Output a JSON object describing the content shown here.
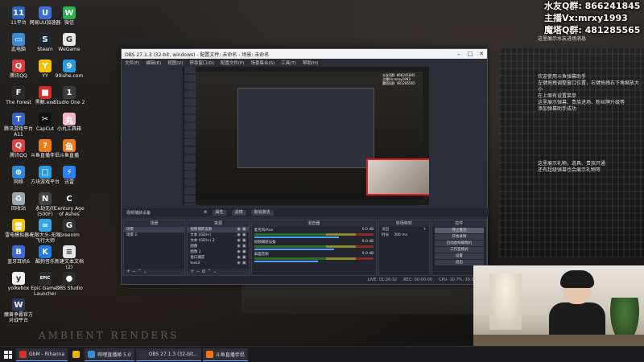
{
  "desktop": {
    "wallpaper_caption": "AMBIENT RENDERS",
    "icons": [
      {
        "label": "11平台",
        "icon": "platform-icon",
        "color": "#2a63c4",
        "glyph": "11"
      },
      {
        "label": "网易UU加速器",
        "icon": "uu-accelerator-icon",
        "color": "#3a6fd8",
        "glyph": "U"
      },
      {
        "label": "微信",
        "icon": "wechat-icon",
        "color": "#27b24a",
        "glyph": "W"
      },
      {
        "label": "此电脑",
        "icon": "computer-icon",
        "color": "#3b8ad9",
        "glyph": "▭"
      },
      {
        "label": "Steam",
        "icon": "steam-icon",
        "color": "#1b2838",
        "glyph": "S"
      },
      {
        "label": "WeGame",
        "icon": "wegame-icon",
        "color": "#e8e8e8",
        "glyph": "G"
      },
      {
        "label": "腾讯QQ",
        "icon": "qq-icon",
        "color": "#e03a3a",
        "glyph": "Q"
      },
      {
        "label": "YY",
        "icon": "yy-icon",
        "color": "#f4c200",
        "glyph": "Y"
      },
      {
        "label": "99ishe.com",
        "icon": "web-icon",
        "color": "#2a9be0",
        "glyph": "9"
      },
      {
        "label": "The Forest",
        "icon": "the-forest-icon",
        "color": "#2b2b2b",
        "glyph": "F"
      },
      {
        "label": "黑鲸.exe",
        "icon": "app-icon",
        "color": "#d92a2a",
        "glyph": "■"
      },
      {
        "label": "Studio One 2",
        "icon": "studio-one-icon",
        "color": "#3c3c3c",
        "glyph": "1"
      },
      {
        "label": "腾讯游戏平台\nA11",
        "icon": "tencent-game-icon",
        "color": "#3464c8",
        "glyph": "T"
      },
      {
        "label": "CapCut",
        "icon": "capcut-icon",
        "color": "#111111",
        "glyph": "✂"
      },
      {
        "label": "小丸工具箱",
        "icon": "toolbox-icon",
        "color": "#f1b6c8",
        "glyph": "丸"
      },
      {
        "label": "腾讯QQ",
        "icon": "qq-icon-2",
        "color": "#e04040",
        "glyph": "Q"
      },
      {
        "label": "斗鱼直播伴侣",
        "icon": "douyu-companion-icon",
        "color": "#f07a1a",
        "glyph": "?"
      },
      {
        "label": "斗鱼直播",
        "icon": "douyu-icon",
        "color": "#f07a1a",
        "glyph": "鱼"
      },
      {
        "label": "网络",
        "icon": "network-icon",
        "color": "#2a8ad9",
        "glyph": "⊕"
      },
      {
        "label": "方块游戏平台",
        "icon": "cube-game-icon",
        "color": "#2a9be0",
        "glyph": "□"
      },
      {
        "label": "迅雷",
        "icon": "thunder-icon",
        "color": "#2e7ff0",
        "glyph": "⚡"
      },
      {
        "label": "回收站",
        "icon": "recycle-bin-icon",
        "color": "#9aa5b1",
        "glyph": "♻"
      },
      {
        "label": "永劫无间\n(500F)",
        "icon": "naraka-icon",
        "color": "#444444",
        "glyph": "N"
      },
      {
        "label": "Century Age\nof Ashes",
        "icon": "century-icon",
        "color": "#222222",
        "glyph": "C"
      },
      {
        "label": "雷电模拟器4",
        "icon": "ldplayer-icon",
        "color": "#f6c200",
        "glyph": "雷"
      },
      {
        "label": "无限大头-无限\n飞行大师",
        "icon": "game-icon",
        "color": "#3aa0e8",
        "glyph": "∞"
      },
      {
        "label": "GreenIm",
        "icon": "greenim-icon",
        "color": "#333333",
        "glyph": "G"
      },
      {
        "label": "蓝牙耳机6",
        "icon": "bluetooth-icon",
        "color": "#3d6ad8",
        "glyph": "B"
      },
      {
        "label": "酷狗音乐",
        "icon": "kugou-icon",
        "color": "#1e7ee8",
        "glyph": "K"
      },
      {
        "label": "新建文本文档\n(2)",
        "icon": "text-document-icon",
        "color": "#e6e6e6",
        "glyph": "≡"
      },
      {
        "label": "yolkebox",
        "icon": "yolkebox-icon",
        "color": "#f2f2f2",
        "glyph": "y"
      },
      {
        "label": "Epic Games\nLauncher",
        "icon": "epic-games-icon",
        "color": "#2b2b2b",
        "glyph": "EPIC"
      },
      {
        "label": "OBS Studio",
        "icon": "obs-icon",
        "color": "#2b2b2b",
        "glyph": "●"
      },
      {
        "label": "魔兽争霸官方\n对战平台",
        "icon": "warcraft-icon",
        "color": "#2a3a5a",
        "glyph": "W"
      }
    ]
  },
  "overlay": {
    "line1": "水友Q群: 866241845",
    "line2": "主播Vx:mrxy1993",
    "line3": "魔塔Q群: 481285565",
    "note": "这里展示水友进场消息",
    "block1": [
      "欢迎使用斗鱼弹幕助手",
      "左键拖拽调整窗口位置，右键拖拽右下角缩放大小",
      "在上面有设置菜单",
      "这里展示弹幕、贵族进场、粉丝牌升级等",
      "添加弹幕助手成功"
    ],
    "block2": [
      "这里展示礼物，道具、贵族开通",
      "还有超级弹幕也会展示礼物等"
    ]
  },
  "obs": {
    "title": "OBS 27.1.3 (32-bit, windows) - 配置文件: 未命名 - 场景: 未命名",
    "menu": [
      "文件(F)",
      "编辑(E)",
      "视图(V)",
      "停靠窗口(D)",
      "配置文件(P)",
      "场景集合(S)",
      "工具(T)",
      "帮助(H)"
    ],
    "preview_text": [
      "水友Q群: 866241845",
      "主播Vx:mrxy1993",
      "魔塔Q群: 481285565"
    ],
    "source_toolbar": {
      "current_source": "视频捕获设备",
      "properties": "属性",
      "filters": "滤镜",
      "deactivate": "取消激活"
    },
    "docks": {
      "scenes": {
        "header": "场景",
        "items": [
          "场景",
          "场景 2"
        ]
      },
      "sources": {
        "header": "来源",
        "items": [
          "视频捕获设备",
          "文本 (GDI+)",
          "文本 (GDI+) 2",
          "图像",
          "图像 2",
          "窗口捕获",
          "text3"
        ]
      },
      "mixer": {
        "header": "混音器",
        "channels": [
          {
            "name": "麦克风/Aux",
            "db": "0.0 dB",
            "level": 0.72
          },
          {
            "name": "视频捕获设备",
            "db": "0.0 dB",
            "level": 0.68
          },
          {
            "name": "桌面音频",
            "db": "0.0 dB",
            "level": 0.55
          }
        ]
      },
      "transitions": {
        "header": "转场特效",
        "type": "淡出",
        "duration_label": "时长",
        "duration": "300 ms"
      },
      "controls": {
        "header": "控件",
        "buttons": [
          "停止推流",
          "开始录制",
          "启动虚拟摄像机",
          "工作室模式",
          "设置",
          "退出"
        ]
      }
    },
    "status": [
      "LIVE: 01:26:32",
      "REC: 00:00:00",
      "CPU: 10.7%, 30.00 fps"
    ]
  },
  "taskbar": {
    "items": [
      {
        "label": "GbM - Rihanna",
        "icon": "netease-music-icon",
        "color": "#d9302b",
        "open": true
      },
      {
        "label": "",
        "icon": "chrome-icon",
        "color": "#e8b400",
        "open": false
      },
      {
        "label": "哔哩直播姬 5.0",
        "icon": "bilibili-icon",
        "color": "#3b8ad9",
        "open": true
      },
      {
        "label": "OBS 27.1.3 (32-bit...",
        "icon": "obs-taskbar-icon",
        "color": "#333333",
        "open": true
      },
      {
        "label": "斗鱼直播伴侣",
        "icon": "douyu-taskbar-icon",
        "color": "#f07a1a",
        "open": true
      }
    ]
  }
}
